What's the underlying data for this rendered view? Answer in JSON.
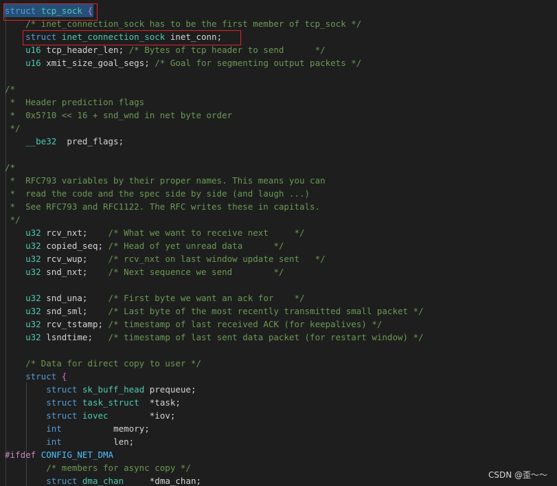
{
  "watermark": "CSDN @歪～～",
  "colors": {
    "background": "#1e1e1e",
    "keyword": "#569cd6",
    "type": "#4ec9b0",
    "comment": "#6a9955",
    "preprocessor": "#c586c0",
    "bracket": "#da70d6",
    "highlight_box": "#e0242b",
    "selection": "#264f78"
  },
  "lines": [
    [
      [
        "kw",
        "struct"
      ],
      [
        "dot",
        "·"
      ],
      [
        "ty",
        "tcp_sock"
      ],
      [
        "dot",
        "·"
      ],
      [
        "br",
        "{"
      ]
    ],
    [
      [
        "sp",
        "    "
      ],
      [
        "cm",
        "/* inet_connection_sock has to be the first member of tcp_sock */"
      ]
    ],
    [
      [
        "sp",
        "    "
      ],
      [
        "kw",
        "struct"
      ],
      [
        "sp",
        " "
      ],
      [
        "ty",
        "inet_connection_sock"
      ],
      [
        "sp",
        " "
      ],
      [
        "id",
        "inet_conn"
      ],
      [
        "pn",
        ";"
      ]
    ],
    [
      [
        "sp",
        "    "
      ],
      [
        "ty",
        "u16"
      ],
      [
        "sp",
        " "
      ],
      [
        "id",
        "tcp_header_len"
      ],
      [
        "pn",
        ";"
      ],
      [
        "sp",
        " "
      ],
      [
        "cm",
        "/* Bytes of tcp header to send      */"
      ]
    ],
    [
      [
        "sp",
        "    "
      ],
      [
        "ty",
        "u16"
      ],
      [
        "sp",
        " "
      ],
      [
        "id",
        "xmit_size_goal_segs"
      ],
      [
        "pn",
        ";"
      ],
      [
        "sp",
        " "
      ],
      [
        "cm",
        "/* Goal for segmenting output packets */"
      ]
    ],
    [],
    [
      [
        "cm",
        "/*"
      ]
    ],
    [
      [
        "cm",
        " *  Header prediction flags"
      ]
    ],
    [
      [
        "cm",
        " *  0x5?10 << 16 + snd_wnd in net byte order"
      ]
    ],
    [
      [
        "cm",
        " */"
      ]
    ],
    [
      [
        "sp",
        "    "
      ],
      [
        "ty",
        "__be32"
      ],
      [
        "sp",
        "  "
      ],
      [
        "id",
        "pred_flags"
      ],
      [
        "pn",
        ";"
      ]
    ],
    [],
    [
      [
        "cm",
        "/*"
      ]
    ],
    [
      [
        "cm",
        " *  RFC793 variables by their proper names. This means you can"
      ]
    ],
    [
      [
        "cm",
        " *  read the code and the spec side by side (and laugh ...)"
      ]
    ],
    [
      [
        "cm",
        " *  See RFC793 and RFC1122. The RFC writes these in capitals."
      ]
    ],
    [
      [
        "cm",
        " */"
      ]
    ],
    [
      [
        "sp",
        "    "
      ],
      [
        "ty",
        "u32"
      ],
      [
        "sp",
        " "
      ],
      [
        "id",
        "rcv_nxt"
      ],
      [
        "pn",
        ";"
      ],
      [
        "sp",
        "    "
      ],
      [
        "cm",
        "/* What we want to receive next     */"
      ]
    ],
    [
      [
        "sp",
        "    "
      ],
      [
        "ty",
        "u32"
      ],
      [
        "sp",
        " "
      ],
      [
        "id",
        "copied_seq"
      ],
      [
        "pn",
        ";"
      ],
      [
        "sp",
        " "
      ],
      [
        "cm",
        "/* Head of yet unread data      */"
      ]
    ],
    [
      [
        "sp",
        "    "
      ],
      [
        "ty",
        "u32"
      ],
      [
        "sp",
        " "
      ],
      [
        "id",
        "rcv_wup"
      ],
      [
        "pn",
        ";"
      ],
      [
        "sp",
        "    "
      ],
      [
        "cm",
        "/* rcv_nxt on last window update sent   */"
      ]
    ],
    [
      [
        "sp",
        "    "
      ],
      [
        "ty",
        "u32"
      ],
      [
        "sp",
        " "
      ],
      [
        "id",
        "snd_nxt"
      ],
      [
        "pn",
        ";"
      ],
      [
        "sp",
        "    "
      ],
      [
        "cm",
        "/* Next sequence we send        */"
      ]
    ],
    [],
    [
      [
        "sp",
        "    "
      ],
      [
        "ty",
        "u32"
      ],
      [
        "sp",
        " "
      ],
      [
        "id",
        "snd_una"
      ],
      [
        "pn",
        ";"
      ],
      [
        "sp",
        "    "
      ],
      [
        "cm",
        "/* First byte we want an ack for    */"
      ]
    ],
    [
      [
        "sp",
        "    "
      ],
      [
        "ty",
        "u32"
      ],
      [
        "sp",
        " "
      ],
      [
        "id",
        "snd_sml"
      ],
      [
        "pn",
        ";"
      ],
      [
        "sp",
        "    "
      ],
      [
        "cm",
        "/* Last byte of the most recently transmitted small packet */"
      ]
    ],
    [
      [
        "sp",
        "    "
      ],
      [
        "ty",
        "u32"
      ],
      [
        "sp",
        " "
      ],
      [
        "id",
        "rcv_tstamp"
      ],
      [
        "pn",
        ";"
      ],
      [
        "sp",
        " "
      ],
      [
        "cm",
        "/* timestamp of last received ACK (for keepalives) */"
      ]
    ],
    [
      [
        "sp",
        "    "
      ],
      [
        "ty",
        "u32"
      ],
      [
        "sp",
        " "
      ],
      [
        "id",
        "lsndtime"
      ],
      [
        "pn",
        ";"
      ],
      [
        "sp",
        "   "
      ],
      [
        "cm",
        "/* timestamp of last sent data packet (for restart window) */"
      ]
    ],
    [],
    [
      [
        "sp",
        "    "
      ],
      [
        "cm",
        "/* Data for direct copy to user */"
      ]
    ],
    [
      [
        "sp",
        "    "
      ],
      [
        "kw",
        "struct"
      ],
      [
        "sp",
        " "
      ],
      [
        "br",
        "{"
      ]
    ],
    [
      [
        "sp",
        "        "
      ],
      [
        "kw",
        "struct"
      ],
      [
        "sp",
        " "
      ],
      [
        "ty",
        "sk_buff_head"
      ],
      [
        "sp",
        " "
      ],
      [
        "id",
        "prequeue"
      ],
      [
        "pn",
        ";"
      ]
    ],
    [
      [
        "sp",
        "        "
      ],
      [
        "kw",
        "struct"
      ],
      [
        "sp",
        " "
      ],
      [
        "ty",
        "task_struct"
      ],
      [
        "sp",
        "  "
      ],
      [
        "pn",
        "*"
      ],
      [
        "id",
        "task"
      ],
      [
        "pn",
        ";"
      ]
    ],
    [
      [
        "sp",
        "        "
      ],
      [
        "kw",
        "struct"
      ],
      [
        "sp",
        " "
      ],
      [
        "ty",
        "iovec"
      ],
      [
        "sp",
        "        "
      ],
      [
        "pn",
        "*"
      ],
      [
        "id",
        "iov"
      ],
      [
        "pn",
        ";"
      ]
    ],
    [
      [
        "sp",
        "        "
      ],
      [
        "kw",
        "int"
      ],
      [
        "sp",
        "          "
      ],
      [
        "id",
        "memory"
      ],
      [
        "pn",
        ";"
      ]
    ],
    [
      [
        "sp",
        "        "
      ],
      [
        "kw",
        "int"
      ],
      [
        "sp",
        "          "
      ],
      [
        "id",
        "len"
      ],
      [
        "pn",
        ";"
      ]
    ],
    [
      [
        "pp",
        "#ifdef"
      ],
      [
        "sp",
        " "
      ],
      [
        "ma",
        "CONFIG_NET_DMA"
      ]
    ],
    [
      [
        "sp",
        "        "
      ],
      [
        "cm",
        "/* members for async copy */"
      ]
    ],
    [
      [
        "sp",
        "        "
      ],
      [
        "kw",
        "struct"
      ],
      [
        "sp",
        " "
      ],
      [
        "ty",
        "dma_chan"
      ],
      [
        "sp",
        "     "
      ],
      [
        "pn",
        "*"
      ],
      [
        "id",
        "dma_chan"
      ],
      [
        "pn",
        ";"
      ]
    ]
  ]
}
